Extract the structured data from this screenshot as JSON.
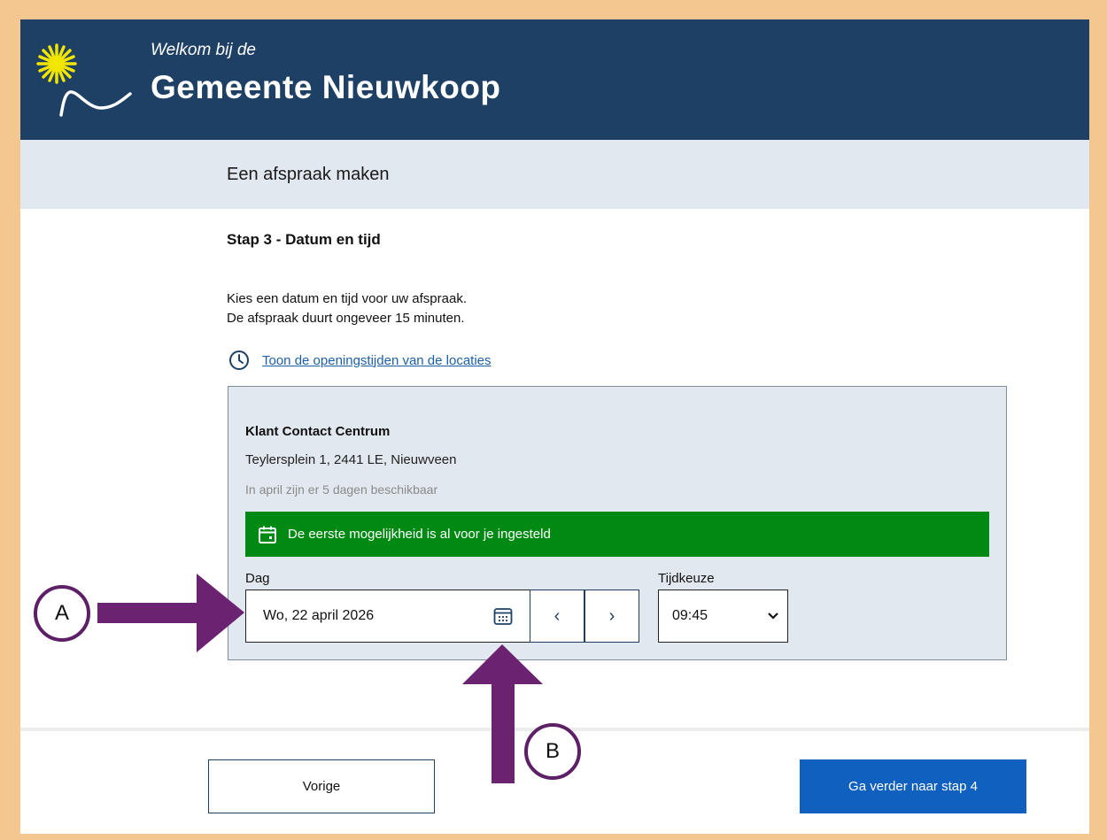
{
  "header": {
    "welcome": "Welkom bij de",
    "municipality": "Gemeente Nieuwkoop"
  },
  "page": {
    "title": "Een afspraak maken"
  },
  "step": {
    "title": "Stap 3 - Datum en tijd",
    "intro_line1": "Kies een datum en tijd voor uw afspraak.",
    "intro_line2": "De afspraak duurt ongeveer 15 minuten.",
    "hours_link": "Toon de openingstijden van de locaties"
  },
  "location": {
    "name": "Klant Contact Centrum",
    "address": "Teylersplein 1, 2441 LE, Nieuwveen",
    "availability": "In april zijn er 5 dagen beschikbaar",
    "notice": "De eerste mogelijkheid is al voor je ingesteld"
  },
  "form": {
    "day_label": "Dag",
    "day_value": "Wo, 22 april 2026",
    "prev_symbol": "‹",
    "next_symbol": "›",
    "time_label": "Tijdkeuze",
    "time_value": "09:45",
    "time_caret": "⌄"
  },
  "footer": {
    "prev_label": "Vorige",
    "next_label": "Ga verder naar stap 4"
  },
  "annotations": {
    "marker_a": "A",
    "marker_b": "B",
    "arrow_color": "#6b2270"
  },
  "colors": {
    "header_bg": "#1e4065",
    "notice_bg": "#008a13",
    "primary_button": "#1060c0",
    "link": "#1d5fa8",
    "page_border": "#f3c78f"
  }
}
